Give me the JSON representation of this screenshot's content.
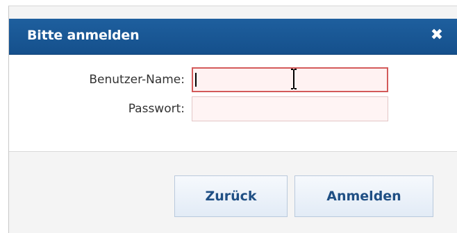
{
  "dialog": {
    "title": "Bitte anmelden",
    "close_icon": "close-icon"
  },
  "form": {
    "username_label": "Benutzer-Name:",
    "username_value": "",
    "password_label": "Passwort:",
    "password_value": ""
  },
  "buttons": {
    "back_label": "Zurück",
    "login_label": "Anmelden"
  },
  "colors": {
    "titlebar": "#1a5895",
    "input_error_border": "#d35a5a",
    "input_background": "#fff4f4",
    "button_text": "#1f4f84"
  }
}
